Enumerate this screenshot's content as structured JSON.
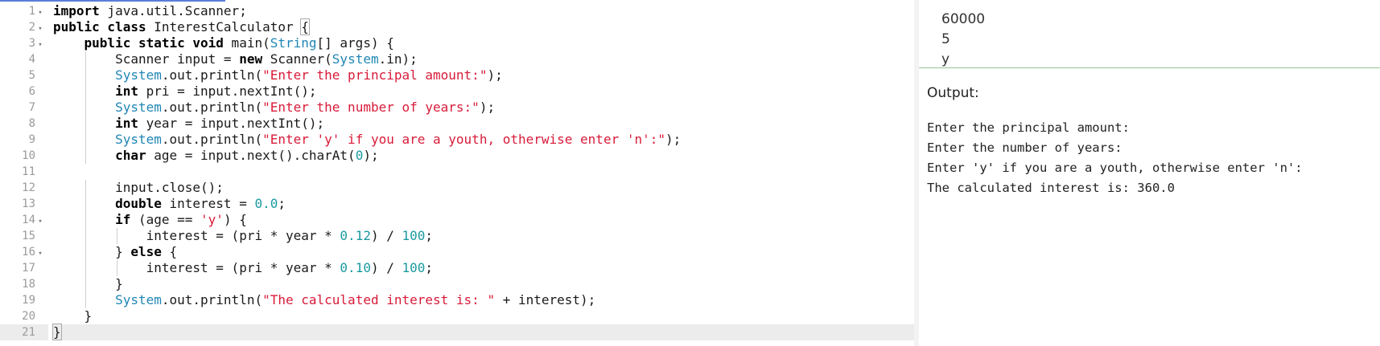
{
  "editor": {
    "active_line": 21,
    "fold_lines": [
      1,
      2,
      3,
      14,
      16
    ],
    "lines": [
      [
        {
          "t": "import",
          "c": "kw"
        },
        {
          "t": " java.util.Scanner;"
        }
      ],
      [
        {
          "t": "public class",
          "c": "kw"
        },
        {
          "t": " InterestCalculator "
        },
        {
          "t": "{",
          "c": "hl-brace"
        }
      ],
      [
        {
          "t": "    "
        },
        {
          "t": "public static void",
          "c": "kw"
        },
        {
          "t": " main("
        },
        {
          "t": "String",
          "c": "ty"
        },
        {
          "t": "[] args) {"
        }
      ],
      [
        {
          "t": "        Scanner input = "
        },
        {
          "t": "new",
          "c": "kw"
        },
        {
          "t": " Scanner("
        },
        {
          "t": "System",
          "c": "ty"
        },
        {
          "t": ".in);"
        }
      ],
      [
        {
          "t": "        "
        },
        {
          "t": "System",
          "c": "ty"
        },
        {
          "t": ".out.println("
        },
        {
          "t": "\"Enter the principal amount:\"",
          "c": "str"
        },
        {
          "t": ");"
        }
      ],
      [
        {
          "t": "        "
        },
        {
          "t": "int",
          "c": "kw"
        },
        {
          "t": " pri = input.nextInt();"
        }
      ],
      [
        {
          "t": "        "
        },
        {
          "t": "System",
          "c": "ty"
        },
        {
          "t": ".out.println("
        },
        {
          "t": "\"Enter the number of years:\"",
          "c": "str"
        },
        {
          "t": ");"
        }
      ],
      [
        {
          "t": "        "
        },
        {
          "t": "int",
          "c": "kw"
        },
        {
          "t": " year = input.nextInt();"
        }
      ],
      [
        {
          "t": "        "
        },
        {
          "t": "System",
          "c": "ty"
        },
        {
          "t": ".out.println("
        },
        {
          "t": "\"Enter 'y' if you are a youth, otherwise enter 'n':\"",
          "c": "str"
        },
        {
          "t": ");"
        }
      ],
      [
        {
          "t": "        "
        },
        {
          "t": "char",
          "c": "kw"
        },
        {
          "t": " age = input.next().charAt("
        },
        {
          "t": "0",
          "c": "num-lit"
        },
        {
          "t": ");"
        }
      ],
      [
        {
          "t": ""
        }
      ],
      [
        {
          "t": "        input.close();"
        }
      ],
      [
        {
          "t": "        "
        },
        {
          "t": "double",
          "c": "kw"
        },
        {
          "t": " interest = "
        },
        {
          "t": "0.0",
          "c": "num-lit"
        },
        {
          "t": ";"
        }
      ],
      [
        {
          "t": "        "
        },
        {
          "t": "if",
          "c": "kw"
        },
        {
          "t": " (age == "
        },
        {
          "t": "'y'",
          "c": "str"
        },
        {
          "t": ") {"
        }
      ],
      [
        {
          "t": "            interest = (pri * year * "
        },
        {
          "t": "0.12",
          "c": "num-lit"
        },
        {
          "t": ") / "
        },
        {
          "t": "100",
          "c": "num-lit"
        },
        {
          "t": ";"
        }
      ],
      [
        {
          "t": "        } "
        },
        {
          "t": "else",
          "c": "kw"
        },
        {
          "t": " {"
        }
      ],
      [
        {
          "t": "            interest = (pri * year * "
        },
        {
          "t": "0.10",
          "c": "num-lit"
        },
        {
          "t": ") / "
        },
        {
          "t": "100",
          "c": "num-lit"
        },
        {
          "t": ";"
        }
      ],
      [
        {
          "t": "        }"
        }
      ],
      [
        {
          "t": "        "
        },
        {
          "t": "System",
          "c": "ty"
        },
        {
          "t": ".out.println("
        },
        {
          "t": "\"The calculated interest is: \"",
          "c": "str"
        },
        {
          "t": " + interest);"
        }
      ],
      [
        {
          "t": "    }"
        }
      ],
      [
        {
          "t": "}",
          "c": "hl-brace"
        }
      ]
    ]
  },
  "input": {
    "lines": [
      "60000",
      "5",
      "y"
    ]
  },
  "output": {
    "label": "Output:",
    "lines": [
      "Enter the principal amount:",
      "Enter the number of years:",
      "Enter 'y' if you are a youth, otherwise enter 'n':",
      "The calculated interest is: 360.0"
    ]
  }
}
